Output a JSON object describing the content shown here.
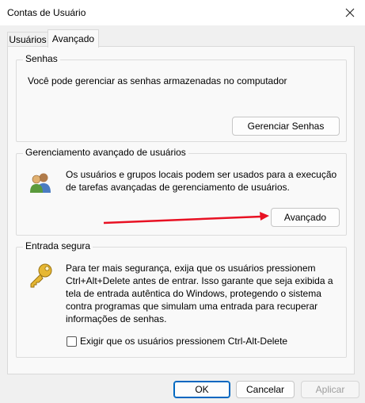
{
  "window": {
    "title": "Contas de Usuário"
  },
  "tabs": [
    {
      "label": "Usuários",
      "active": false
    },
    {
      "label": "Avançado",
      "active": true
    }
  ],
  "senhas": {
    "label": "Senhas",
    "description": "Você pode gerenciar as senhas armazenadas no computador",
    "button": "Gerenciar Senhas"
  },
  "gerenciamento": {
    "label": "Gerenciamento avançado de usuários",
    "line1": "Os usuários e grupos locais podem ser usados para a execução",
    "line2": "de tarefas avançadas de gerenciamento de usuários.",
    "button": "Avançado",
    "icon": "users-group-icon"
  },
  "entrada": {
    "label": "Entrada segura",
    "lines": [
      "Para ter mais segurança, exija que os usuários pressionem",
      "Ctrl+Alt+Delete antes de entrar. Isso garante que seja exibida a",
      "tela de entrada autêntica do Windows, protegendo o sistema",
      "contra programas que simulam uma entrada para recuperar",
      "informações de senhas."
    ],
    "checkbox_label": "Exigir que os usuários pressionem Ctrl-Alt-Delete",
    "checkbox_checked": false,
    "icon": "key-icon"
  },
  "buttons": {
    "ok": "OK",
    "cancel": "Cancelar",
    "apply": "Aplicar"
  },
  "annotation": {
    "arrow_color": "#e81123"
  },
  "colors": {
    "accent": "#0067c0"
  }
}
